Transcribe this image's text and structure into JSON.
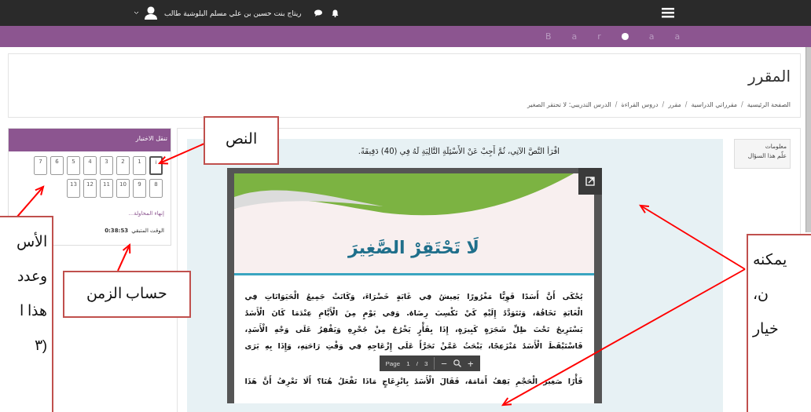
{
  "topbar": {
    "user_name": "ريتاج بنت حسين بن علي مسلم البلوشية طالب"
  },
  "banner_letters": [
    "a",
    "a",
    "r",
    "a",
    "B"
  ],
  "header": {
    "title": "المقرر",
    "breadcrumbs": [
      {
        "label": "الصفحة الرئيسية",
        "separator": "/"
      },
      {
        "label": "مقرراتي الدراسية",
        "separator": "/"
      },
      {
        "label": "مقرر",
        "separator": "/"
      },
      {
        "label": "دروس القراءة",
        "separator": "/"
      },
      {
        "label": "الدرس التدريبي: لا تحتقر الصغير"
      }
    ]
  },
  "quiz_nav": {
    "title": "تنقل الاختبار",
    "questions": [
      {
        "label": "i",
        "selected": true
      },
      {
        "label": "1",
        "selected": false
      },
      {
        "label": "2",
        "selected": false
      },
      {
        "label": "3",
        "selected": false
      },
      {
        "label": "4",
        "selected": false
      },
      {
        "label": "5",
        "selected": false
      },
      {
        "label": "6",
        "selected": false
      },
      {
        "label": "7",
        "selected": false
      },
      {
        "label": "8",
        "selected": false
      },
      {
        "label": "9",
        "selected": false
      },
      {
        "label": "10",
        "selected": false
      },
      {
        "label": "11",
        "selected": false
      },
      {
        "label": "12",
        "selected": false
      },
      {
        "label": "13",
        "selected": false
      }
    ],
    "finish_link": "إنهاء المحاولة...",
    "time_label": "الوقت المتبقي",
    "time_value": "0:38:53"
  },
  "question_info": {
    "title": "معلومات",
    "flag_label": "علّم هذا السؤال"
  },
  "question": {
    "instruction": "اقْرَأ النَّصَّ الآتِي، ثُمَّ أَجِبْ عَنْ الأَسْئِلَةِ التَّالِيَةِ لَهُ فِي (40) دَقِيقَةً.",
    "document": {
      "title": "لَا تَحْتَقِرْ الصَّغِيرَ",
      "lines": [
        "يُحْكَى أَنَّ أَسَدًا قَوِيًّا مَغْرُورًا يَعِيشُ فِي غَابَةٍ خَضْرَاءَ، وَكَانَتْ جَمِيعُ الْحَيَوَانَاتِ فِي",
        "الْغَابَةِ تَخَافُهُ، وَتَتَوَدَّدُ إِلَيْهِ كَيْ تَكْسِبَ رِضَاهُ. وَفِي يَوْمٍ مِنَ الْأَيَّامِ عِنْدَمَا كَانَ الْأَسَدُ",
        "يَسْتَرِيحُ تَحْتَ ظِلِّ شَجَرَةٍ كَبِيرَةٍ، إِذَا بِفَأْرٍ يَخْرُجُ مِنْ جُحْرِهِ وَيَقْفِزُ عَلَى وَجْهِ الْأَسَدِ،",
        "فَاسْتَيْقَظَ الْأَسَدُ مُنْزَعِجًا، يَبْحَثُ عَمَّنْ تَجَرَّأَ عَلَى إِزْعَاجِهِ فِي وَقْتِ رَاحَتِهِ، وَإِذَا بِهِ يَرَى",
        "فَأْرًا صَغِيرَ الْحَجْمِ يَقِفُ أَمَامَهُ، فَقَالَ الْأَسَدُ بِانْزِعَاجٍ مَاذَا تَفْعَلُ هُنَا؟ أَلَا تَعْرِفُ أَنَّ هَذَا"
      ],
      "toolbar": {
        "page_label": "Page",
        "page": "1",
        "separator": "/",
        "pages": "3",
        "zoom_out": "−",
        "zoom_in": "+"
      }
    }
  },
  "annotations": [
    {
      "kind": "tools",
      "lines": [
        "يمكنه",
        "ن،",
        "خيار"
      ]
    },
    {
      "kind": "text",
      "lines": [
        "النص"
      ]
    },
    {
      "kind": "timer",
      "lines": [
        "حساب الزمن"
      ]
    },
    {
      "kind": "questions",
      "lines": [
        "الأس",
        "وعدد",
        "هذا ا",
        "(٣"
      ]
    }
  ]
}
